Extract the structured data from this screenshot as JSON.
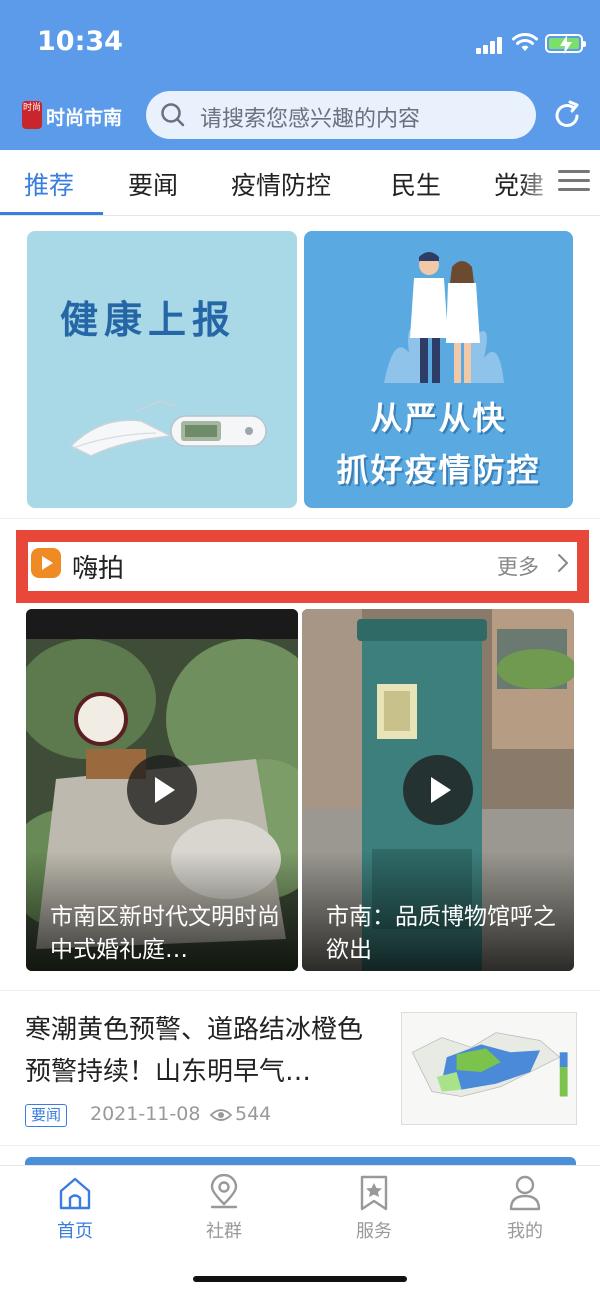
{
  "status_bar": {
    "time": "10:34"
  },
  "header": {
    "logo_seal_text": "时尚",
    "city_name": "时尚市南",
    "search_placeholder": "请搜索您感兴趣的内容"
  },
  "tabs": [
    {
      "label": "推荐",
      "active": true
    },
    {
      "label": "要闻",
      "active": false
    },
    {
      "label": "疫情防控",
      "active": false
    },
    {
      "label": "民生",
      "active": false
    },
    {
      "label": "党建",
      "active": false
    }
  ],
  "banners": {
    "health_report": {
      "title": "健康上报"
    },
    "epidemic": {
      "line1": "从严从快",
      "line2": "抓好疫情防控"
    }
  },
  "section": {
    "title": "嗨拍",
    "more_label": "更多"
  },
  "videos": [
    {
      "title": "市南区新时代文明时尚中式婚礼庭…"
    },
    {
      "title": "市南：品质博物馆呼之欲出"
    }
  ],
  "news": {
    "title": "寒潮黄色预警、道路结冰橙色预警持续！山东明早气…",
    "tag": "要闻",
    "date": "2021-11-08",
    "views": "544"
  },
  "bottom_nav": [
    {
      "label": "首页",
      "icon": "home-icon",
      "active": true
    },
    {
      "label": "社群",
      "icon": "location-pin-icon",
      "active": false
    },
    {
      "label": "服务",
      "icon": "bookmark-star-icon",
      "active": false
    },
    {
      "label": "我的",
      "icon": "user-icon",
      "active": false
    }
  ],
  "colors": {
    "header_blue": "#5b9bea",
    "accent": "#3a7de0",
    "highlight_red": "#e8483a"
  }
}
